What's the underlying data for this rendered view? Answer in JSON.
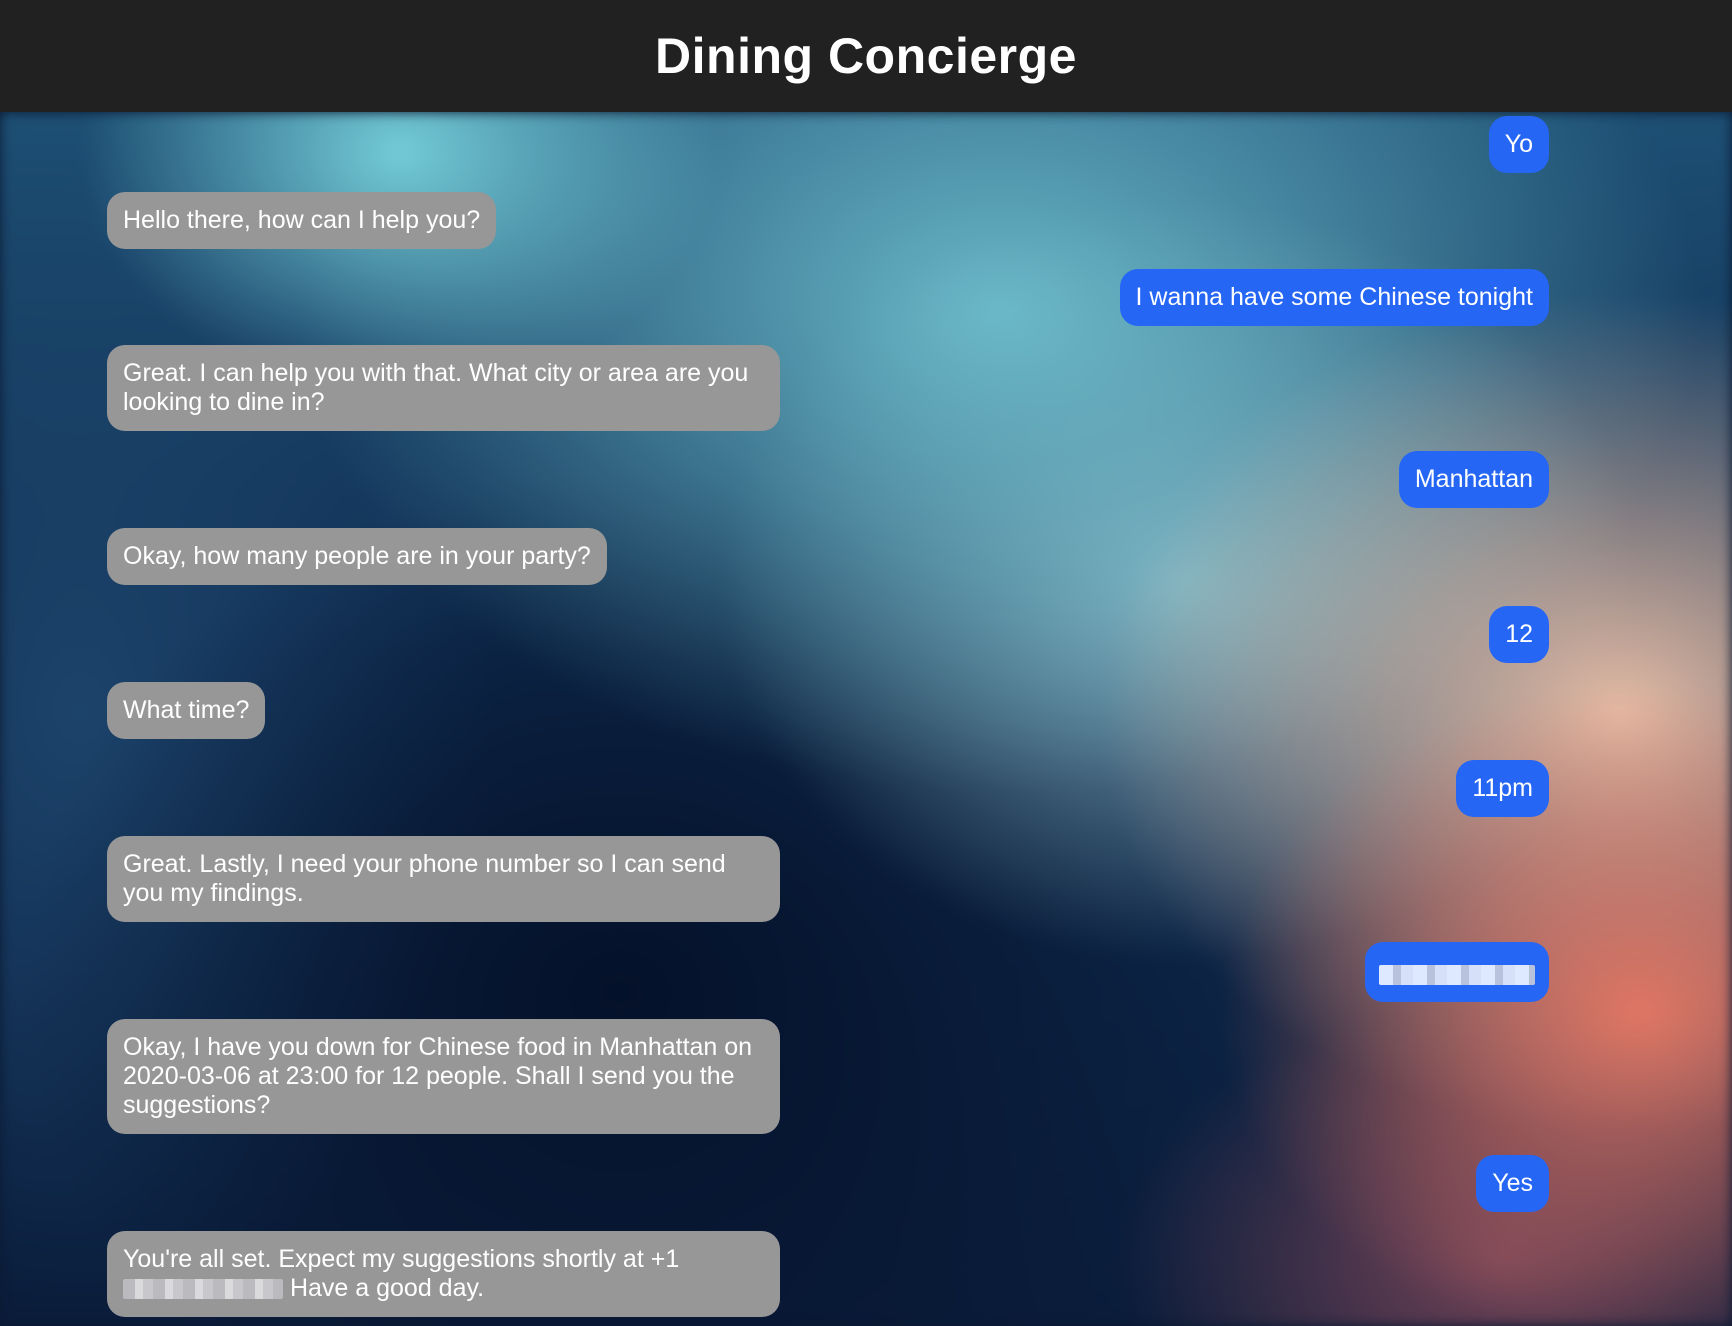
{
  "header": {
    "title": "Dining Concierge"
  },
  "messages": [
    {
      "from": "user",
      "text": "Yo"
    },
    {
      "from": "bot",
      "text": "Hello there, how can I help you?"
    },
    {
      "from": "user",
      "text": "I wanna have some Chinese tonight"
    },
    {
      "from": "bot",
      "text": "Great. I can help you with that. What city or area are you looking to dine in?"
    },
    {
      "from": "user",
      "text": "Manhattan"
    },
    {
      "from": "bot",
      "text": "Okay, how many people are in your party?"
    },
    {
      "from": "user",
      "text": "12"
    },
    {
      "from": "bot",
      "text": "What time?"
    },
    {
      "from": "user",
      "text": "11pm"
    },
    {
      "from": "bot",
      "text": "Great. Lastly, I need your phone number so I can send you my findings."
    },
    {
      "from": "user",
      "text": ""
    },
    {
      "from": "bot",
      "text": "Okay, I have you down for Chinese food in Manhattan on 2020-03-06 at 23:00 for 12 people. Shall I send you the suggestions?"
    },
    {
      "from": "user",
      "text": "Yes"
    },
    {
      "from": "bot",
      "text_before": "You're all set. Expect my suggestions shortly at +1",
      "text_after": " Have a good day."
    }
  ],
  "colors": {
    "header_bg": "#212121",
    "user_bubble": "#2566f5",
    "bot_bubble": "#979797"
  }
}
